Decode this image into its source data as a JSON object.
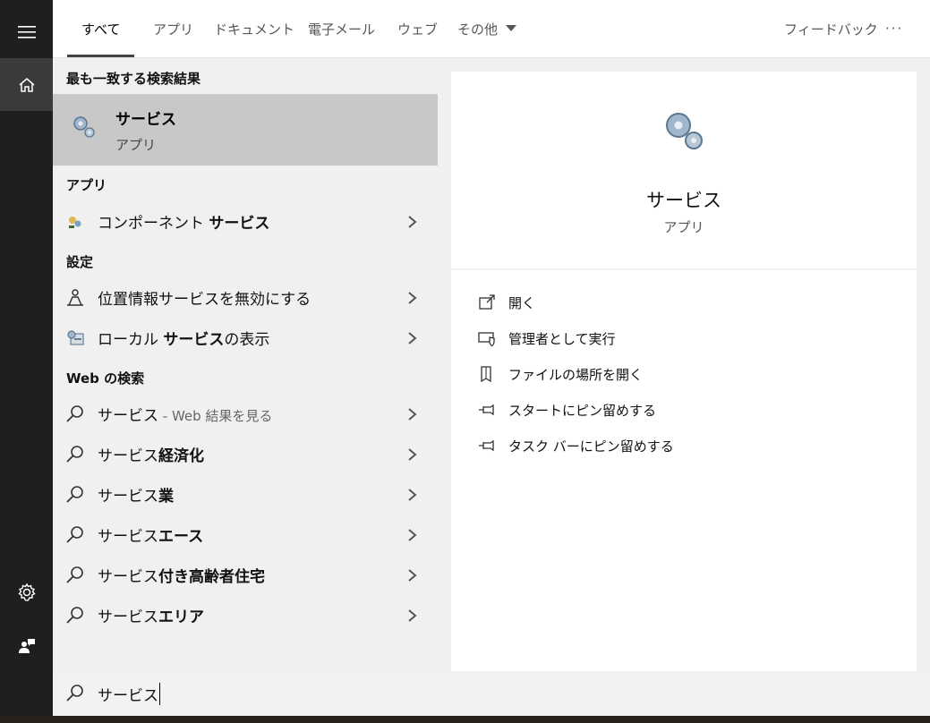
{
  "tabs": [
    {
      "label": "すべて"
    },
    {
      "label": "アプリ"
    },
    {
      "label": "ドキュメント"
    },
    {
      "label": "電子メール"
    },
    {
      "label": "ウェブ"
    },
    {
      "label": "その他"
    }
  ],
  "feedback_label": "フィードバック",
  "more_label": "···",
  "sections": {
    "best_match": "最も一致する検索結果",
    "apps": "アプリ",
    "settings": "設定",
    "web": "Web の検索"
  },
  "best_match": {
    "title": "サービス",
    "type": "アプリ"
  },
  "apps": [
    {
      "plain": "コンポーネント ",
      "bold": "サービス"
    }
  ],
  "settings": [
    {
      "plain": "位置情報サービスを無効にする",
      "bold": ""
    },
    {
      "plain": "ローカル ",
      "bold": "サービス",
      "plain2": "の表示"
    }
  ],
  "web": [
    {
      "plain": "サービス",
      "sub": " - Web 結果を見る"
    },
    {
      "plain": "サービス",
      "bold": "経済化"
    },
    {
      "plain": "サービス",
      "bold": "業"
    },
    {
      "plain": "サービス",
      "bold": "エース"
    },
    {
      "plain": "サービス",
      "bold": "付き高齢者住宅"
    },
    {
      "plain": "サービス",
      "bold": "エリア"
    }
  ],
  "detail": {
    "title": "サービス",
    "type": "アプリ"
  },
  "actions": [
    {
      "label": "開く",
      "icon": "open-icon"
    },
    {
      "label": "管理者として実行",
      "icon": "shield-icon"
    },
    {
      "label": "ファイルの場所を開く",
      "icon": "file-location-icon"
    },
    {
      "label": "スタートにピン留めする",
      "icon": "pin-icon"
    },
    {
      "label": "タスク バーにピン留めする",
      "icon": "pin-icon"
    }
  ],
  "search": {
    "value": "サービス"
  },
  "colors": {
    "sidebar": "#1f1f1f",
    "highlight": "#c8c8c8",
    "panel": "#f0f0f0"
  }
}
